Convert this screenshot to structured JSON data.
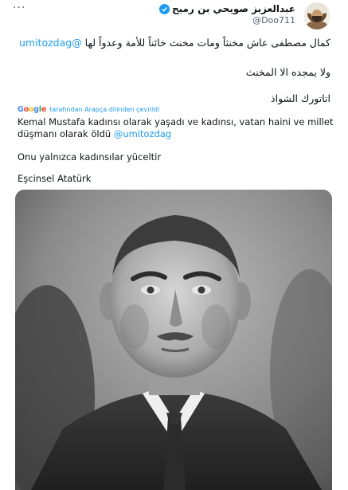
{
  "author": {
    "display_name": "عبدالعزيز صويحي بن رميح",
    "handle": "@Doo711",
    "more_label": "···"
  },
  "tweet": {
    "arabic_line1_text": "كمال مصطفى عاش مخنثاً ومات مخنث خائناً للأمة وعدواً لها",
    "arabic_line1_mention": "@umitozdag",
    "arabic_line2": "ولا يمجده الا المخنث",
    "arabic_line3": "اتاتورك الشواذ"
  },
  "translation": {
    "provider_letters": [
      "G",
      "o",
      "o",
      "g",
      "l",
      "e"
    ],
    "credit_text": "tarafından Arapça dilinden çevrildi",
    "line1": "Kemal Mustafa kadınsı olarak yaşadı ve kadınsı, vatan haini ve millet",
    "line2_text": "düşmanı olarak öldü",
    "line2_mention": "@umitozdag",
    "line3": "Onu yalnızca kadınsılar yüceltir",
    "line4": "Eşcinsel Atatürk"
  },
  "media": {
    "type": "black-and-white portrait photo"
  },
  "colors": {
    "accent": "#1d9bf0",
    "text": "#0f1419",
    "secondary": "#536471"
  }
}
